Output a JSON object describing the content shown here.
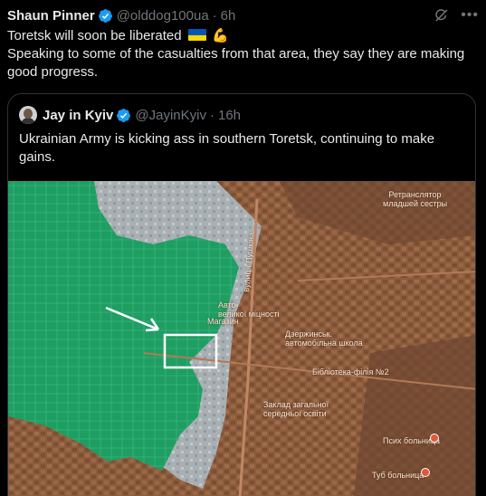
{
  "tweet": {
    "author_name": "Shaun Pinner",
    "handle": "@olddog100ua",
    "separator": "·",
    "time": "6h",
    "text_line1": "Toretsk will soon be liberated",
    "text_line2": "Speaking to some of the casualties from that area, they say they are making good progress."
  },
  "quote": {
    "author_name": "Jay in Kyiv",
    "handle": "@JayinKyiv",
    "separator": "·",
    "time": "16h",
    "text": "Ukrainian Army is kicking ass in southern Toretsk, continuing to make gains."
  },
  "map": {
    "labels": {
      "repeater": "Ретранслятор\nмладшей сестры",
      "street": "вулиця Пушкіна",
      "auto": "Авто\nвеликої міцності",
      "magazin": "Магазин",
      "school": "Дзержинськ.\nавтомобільна школа",
      "library": "Бібліотека-філія №2",
      "school2": "Заклад загальної\nсередньої освіти",
      "hospital": "Псих больница",
      "tb_hospital": "Туб больница"
    }
  },
  "colors": {
    "verified": "#1d9bf0",
    "muted": "#71767b",
    "border": "#2f3336",
    "map_green": "#1f9e63",
    "map_gray": "#a9b0b3",
    "map_brown": "#8a5a3b"
  },
  "icons": {
    "verified": "verified-badge-icon",
    "grok": "grok-icon",
    "more": "more-icon",
    "arrow": "arrow-icon"
  }
}
